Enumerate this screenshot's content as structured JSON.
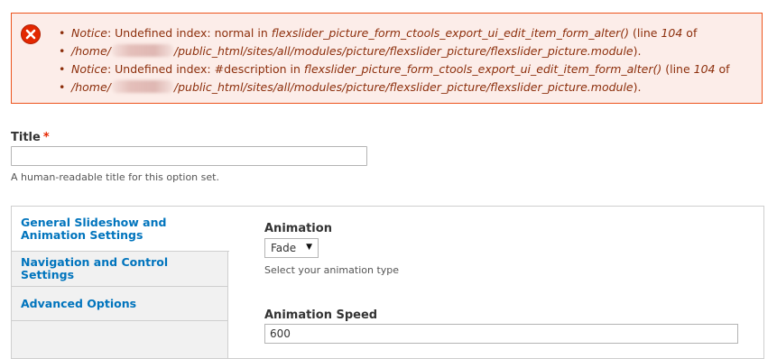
{
  "messages": {
    "errors": [
      {
        "label": "Notice",
        "text": ": Undefined index: normal in ",
        "function": "flexslider_picture_form_ctools_export_ui_edit_item_form_alter()",
        "line_prefix": " (line ",
        "line": "104",
        "line_suffix": " of",
        "path_start": "/home/",
        "path_end": "/public_html/sites/all/modules/picture/flexslider_picture/flexslider_picture.module",
        "end": ")."
      },
      {
        "label": "Notice",
        "text": ": Undefined index: #description in ",
        "function": "flexslider_picture_form_ctools_export_ui_edit_item_form_alter()",
        "line_prefix": " (line ",
        "line": "104",
        "line_suffix": " of",
        "path_start": "/home/",
        "path_end": "/public_html/sites/all/modules/picture/flexslider_picture/flexslider_picture.module",
        "end": ")."
      }
    ],
    "icon": "error-circle-x-icon",
    "colors": {
      "background": "#fcede9",
      "border": "#ed541d",
      "text": "#8c2e0b",
      "icon": "#e32700"
    }
  },
  "title_field": {
    "label": "Title",
    "required_marker": "*",
    "value": "",
    "description": "A human-readable title for this option set."
  },
  "vertical_tabs": [
    {
      "label_line1": "General Slideshow and",
      "label_line2": "Animation Settings",
      "selected": true
    },
    {
      "label_line1": "Navigation and Control Settings",
      "label_line2": "",
      "selected": false
    },
    {
      "label_line1": "Advanced Options",
      "label_line2": "",
      "selected": false
    }
  ],
  "pane": {
    "animation": {
      "label": "Animation",
      "selected": "Fade",
      "description": "Select your animation type"
    },
    "animation_speed": {
      "label": "Animation Speed",
      "value": "600"
    }
  },
  "colors": {
    "link": "#0074bd",
    "required": "#e62600"
  }
}
